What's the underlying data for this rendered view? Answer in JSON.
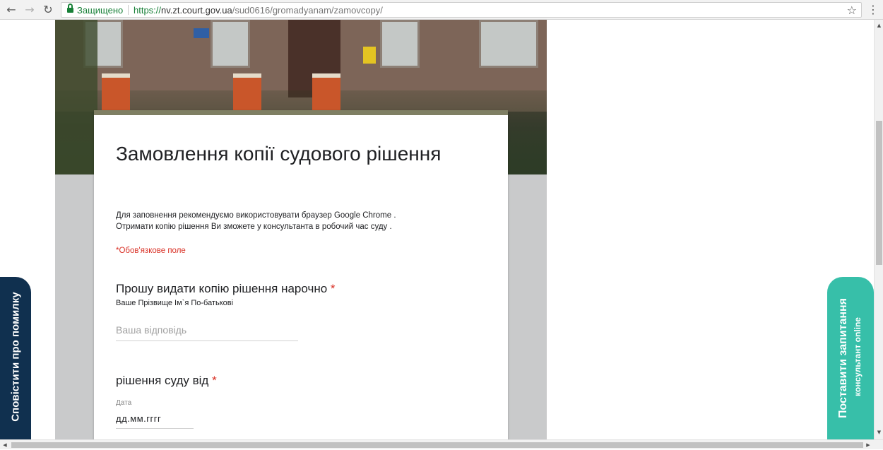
{
  "browser": {
    "security_label": "Защищено",
    "url_protocol": "https://",
    "url_host": "nv.zt.court.gov.ua",
    "url_path": "/sud0616/gromadyanam/zamovcopy/",
    "icons": {
      "back": "←",
      "forward": "→",
      "reload": "↻",
      "star": "☆",
      "menu": "⋮"
    }
  },
  "form": {
    "title": "Замовлення копії судового рішення",
    "description_line1": "Для заповнення рекомендуємо використовувати браузер Google Chrome .",
    "description_line2": "Отримати копію рішення Ви зможете у консультанта  в робочий час суду .",
    "required_note": "*Обов'язкове поле",
    "questions": [
      {
        "title": "Прошу видати копію рішення нарочно",
        "required_mark": "*",
        "help_text": "Ваше Прізвище Ім`я По-батькові",
        "placeholder": "Ваша відповідь"
      },
      {
        "title": "рішення суду від",
        "required_mark": "*",
        "field_label": "Дата",
        "date_placeholder": "дд.мм.гггг"
      }
    ],
    "accent_color": "#7f7f63",
    "required_color": "#d93025"
  },
  "side_tabs": {
    "left_label": "Сповістити про помилку",
    "left_color": "#10304f",
    "right_label": "Поставити запитання",
    "right_sublabel": "консультант online",
    "right_color": "#37bfa9"
  },
  "scrollbars": {
    "up": "▲",
    "down": "▼",
    "left": "◀",
    "right": "▶"
  }
}
